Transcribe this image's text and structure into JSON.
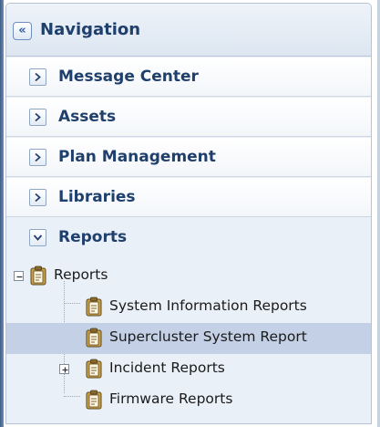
{
  "navigation": {
    "title": "Navigation",
    "collapse_glyph": "«",
    "collapse_icon": "double-chevron-left-icon"
  },
  "accordions": [
    {
      "label": "Message Center",
      "state": "collapsed"
    },
    {
      "label": "Assets",
      "state": "collapsed"
    },
    {
      "label": "Plan Management",
      "state": "collapsed"
    },
    {
      "label": "Libraries",
      "state": "collapsed"
    },
    {
      "label": "Reports",
      "state": "expanded"
    }
  ],
  "tree": {
    "root": {
      "label": "Reports",
      "expanded": true,
      "icon": "clipboard-icon"
    },
    "children": [
      {
        "label": "System Information Reports",
        "selected": false,
        "expandable": false
      },
      {
        "label": "Supercluster System Report",
        "selected": true,
        "expandable": false
      },
      {
        "label": "Incident Reports",
        "selected": false,
        "expandable": true
      },
      {
        "label": "Firmware Reports",
        "selected": false,
        "expandable": false
      }
    ]
  },
  "colors": {
    "header_text": "#1f3f6c",
    "selected_row": "#c3d0e6",
    "panel_background": "#eaf0f7",
    "icon_fill": "#c9a24a"
  }
}
